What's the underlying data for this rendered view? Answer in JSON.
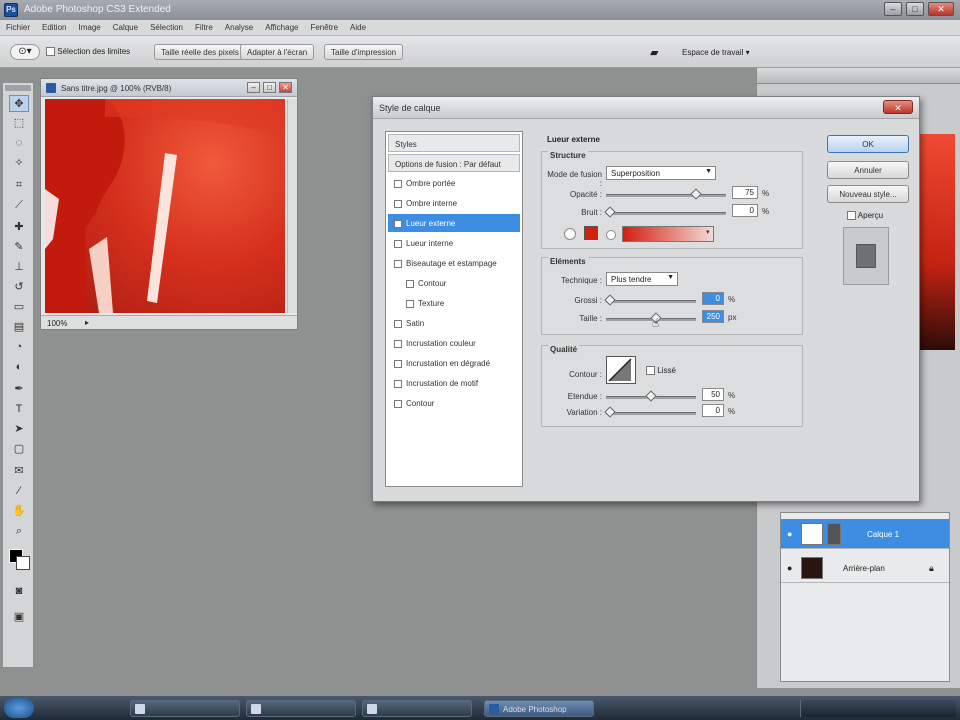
{
  "window": {
    "title": "Adobe Photoshop CS3 Extended"
  },
  "menubar": [
    "Fichier",
    "Edition",
    "Image",
    "Calque",
    "Sélection",
    "Filtre",
    "Analyse",
    "Affichage",
    "Fenêtre",
    "Aide"
  ],
  "optionsbar": {
    "checkbox_label": "Sélection des limites",
    "btn1": "Taille réelle des pixels",
    "btn2": "Adapter à l'écran",
    "btn3": "Taille d'impression",
    "workspace": "Espace de travail"
  },
  "document": {
    "title": "Sans titre.jpg @ 100% (RVB/8)",
    "zoom": "100%"
  },
  "dialog": {
    "title": "Style de calque",
    "list": [
      {
        "label": "Styles",
        "type": "head"
      },
      {
        "label": "Options de fusion : Par défaut",
        "type": "head"
      },
      {
        "label": "Ombre portée",
        "type": "check"
      },
      {
        "label": "Ombre interne",
        "type": "check"
      },
      {
        "label": "Lueur externe",
        "type": "selected"
      },
      {
        "label": "Lueur interne",
        "type": "check"
      },
      {
        "label": "Biseautage et estampage",
        "type": "check"
      },
      {
        "label": "Contour",
        "type": "indent"
      },
      {
        "label": "Texture",
        "type": "indent"
      },
      {
        "label": "Satin",
        "type": "check"
      },
      {
        "label": "Incrustation couleur",
        "type": "check"
      },
      {
        "label": "Incrustation en dégradé",
        "type": "check"
      },
      {
        "label": "Incrustation de motif",
        "type": "check"
      },
      {
        "label": "Contour",
        "type": "check"
      }
    ],
    "section_title": "Lueur externe",
    "structure": {
      "title": "Structure",
      "blend_label": "Mode de fusion :",
      "blend_value": "Superposition",
      "opacity_label": "Opacité :",
      "opacity_value": "75",
      "noise_label": "Bruit :",
      "noise_value": "0",
      "percent": "%"
    },
    "elements": {
      "title": "Eléments",
      "technique_label": "Technique :",
      "technique_value": "Plus tendre",
      "spread_label": "Grossi :",
      "spread_value": "0",
      "size_label": "Taille :",
      "size_value": "250",
      "px": "px",
      "percent": "%"
    },
    "quality": {
      "title": "Qualité",
      "contour_label": "Contour :",
      "lisse_label": "Lissé",
      "range_label": "Etendue :",
      "range_value": "50",
      "jitter_label": "Variation :",
      "jitter_value": "0",
      "percent": "%"
    },
    "buttons": {
      "ok": "OK",
      "cancel": "Annuler",
      "new_style": "Nouveau style...",
      "preview": "Aperçu"
    }
  },
  "layers": [
    {
      "name": "Calque 1",
      "selected": true
    },
    {
      "name": "Arrière-plan",
      "selected": false
    }
  ],
  "taskbar": [
    {
      "label": "",
      "active": false
    },
    {
      "label": "",
      "active": false
    },
    {
      "label": "",
      "active": false
    },
    {
      "label": "",
      "active": false
    },
    {
      "label": "Adobe Photoshop",
      "active": true
    }
  ],
  "colors": {
    "accent": "#3d8ee2",
    "glow": "#d21f12"
  }
}
